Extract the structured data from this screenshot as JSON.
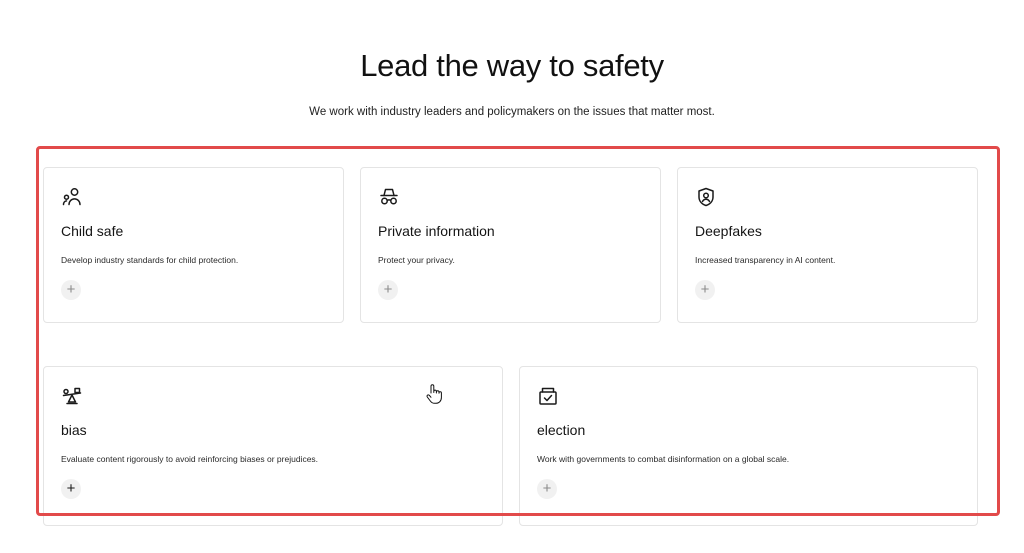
{
  "heading": "Lead the way to safety",
  "subheading": "We work with industry leaders and policymakers on the issues that matter most.",
  "cards": [
    {
      "icon": "children-icon",
      "title": "Child safe",
      "description": "Develop industry standards for child protection.",
      "expand_symbol": "+"
    },
    {
      "icon": "incognito-icon",
      "title": "Private information",
      "description": "Protect your privacy.",
      "expand_symbol": "+"
    },
    {
      "icon": "shield-user-icon",
      "title": "Deepfakes",
      "description": "Increased transparency in AI content.",
      "expand_symbol": "+"
    },
    {
      "icon": "balance-scale-icon",
      "title": "bias",
      "description": "Evaluate content rigorously to avoid reinforcing biases or prejudices.",
      "expand_symbol": "+"
    },
    {
      "icon": "ballot-box-icon",
      "title": "election",
      "description": "Work with governments to combat disinformation on a global scale.",
      "expand_symbol": "+"
    }
  ],
  "colors": {
    "highlight_border": "#e24a4a",
    "card_border": "#e4e4e4",
    "plus_background": "#f1f1f1"
  }
}
